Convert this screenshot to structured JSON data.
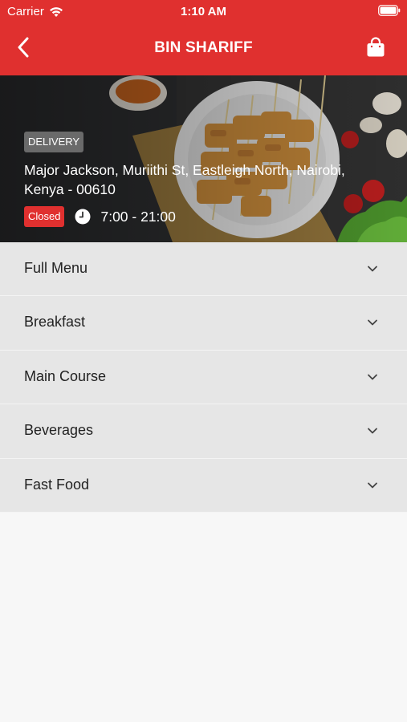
{
  "status_bar": {
    "carrier": "Carrier",
    "time": "1:10 AM"
  },
  "nav": {
    "title": "BIN SHARIFF",
    "back_icon": "chevron-left-icon",
    "bag_icon": "shopping-bag-icon"
  },
  "restaurant": {
    "service_badge": "DELIVERY",
    "address": "Major Jackson, Muriithi St, Eastleigh North, Nairobi, Kenya - 00610",
    "status": "Closed",
    "hours": "7:00 - 21:00"
  },
  "menu": {
    "categories": [
      {
        "label": "Full Menu"
      },
      {
        "label": "Breakfast"
      },
      {
        "label": "Main Course"
      },
      {
        "label": "Beverages"
      },
      {
        "label": "Fast Food"
      }
    ]
  },
  "colors": {
    "accent": "#e0302f",
    "row_bg": "#e6e6e6",
    "page_bg": "#f7f7f7"
  }
}
